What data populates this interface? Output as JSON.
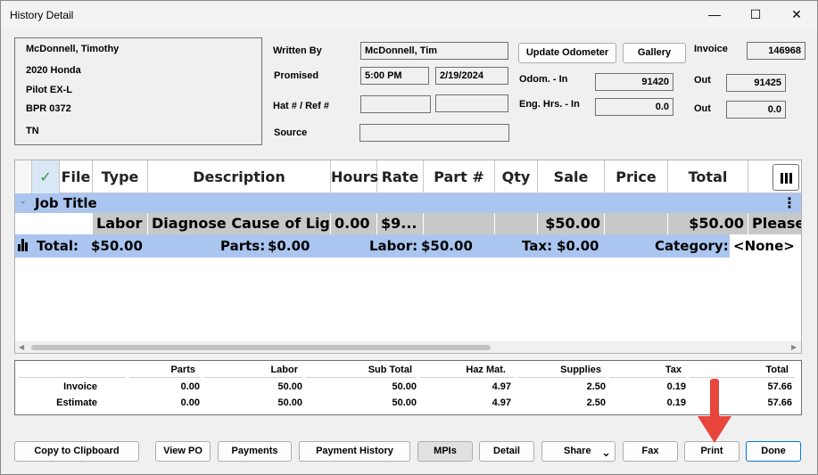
{
  "window": {
    "title": "History Detail",
    "minimize": "—",
    "maximize": "☐",
    "close": "✕"
  },
  "customer": {
    "name": "McDonnell, Timothy",
    "vehicle_year_make": "2020 Honda",
    "vehicle_model": "Pilot EX-L",
    "plate": "BPR 0372",
    "state": "TN"
  },
  "info": {
    "written_by_label": "Written By",
    "written_by": "McDonnell, Tim",
    "promised_label": "Promised",
    "promised_time": "5:00 PM",
    "promised_date": "2/19/2024",
    "hat_ref_label": "Hat # / Ref #",
    "hat": "",
    "ref": "",
    "source_label": "Source",
    "source": ""
  },
  "vehicle_meta": {
    "update_odometer": "Update Odometer",
    "gallery": "Gallery",
    "invoice_label": "Invoice",
    "invoice": "146968",
    "odom_in_label": "Odom. - In",
    "odom_in": "91420",
    "out_label": "Out",
    "odom_out": "91425",
    "eng_in_label": "Eng. Hrs. - In",
    "eng_in": "0.0",
    "eng_out": "0.0"
  },
  "grid": {
    "headers": {
      "check": "✓",
      "file": "File",
      "type": "Type",
      "description": "Description",
      "hours": "Hours",
      "rate": "Rate",
      "part": "Part #",
      "qty": "Qty",
      "sale": "Sale",
      "price": "Price",
      "total": "Total"
    },
    "job_title": "Job Title",
    "line": {
      "type": "Labor",
      "description": "Diagnose Cause of Light",
      "hours": "0.00",
      "rate": "$9...",
      "sale": "$50.00",
      "total": "$50.00",
      "extra": "Please ,"
    },
    "totals_row": {
      "total_label": "Total:",
      "total": "$50.00",
      "parts_label": "Parts:",
      "parts": "$0.00",
      "labor_label": "Labor:",
      "labor": "$50.00",
      "tax_label": "Tax:",
      "tax": "$0.00",
      "category_label": "Category:",
      "category": "<None>"
    }
  },
  "summary": {
    "headers": {
      "parts": "Parts",
      "labor": "Labor",
      "subtotal": "Sub Total",
      "haz": "Haz Mat.",
      "supplies": "Supplies",
      "tax": "Tax",
      "total": "Total"
    },
    "invoice": {
      "label": "Invoice",
      "parts": "0.00",
      "labor": "50.00",
      "subtotal": "50.00",
      "haz": "4.97",
      "supplies": "2.50",
      "tax": "0.19",
      "total": "57.66"
    },
    "estimate": {
      "label": "Estimate",
      "parts": "0.00",
      "labor": "50.00",
      "subtotal": "50.00",
      "haz": "4.97",
      "supplies": "2.50",
      "tax": "0.19",
      "total": "57.66"
    }
  },
  "buttons": {
    "copy": "Copy to Clipboard",
    "view_po": "View PO",
    "payments": "Payments",
    "payment_history": "Payment History",
    "mpis": "MPIs",
    "detail": "Detail",
    "share": "Share",
    "fax": "Fax",
    "print": "Print",
    "done": "Done"
  },
  "colors": {
    "row_blue": "#aac6f0",
    "row_gray": "#c8c8c8",
    "arrow": "#e8453c",
    "check": "#2e9b3a"
  }
}
